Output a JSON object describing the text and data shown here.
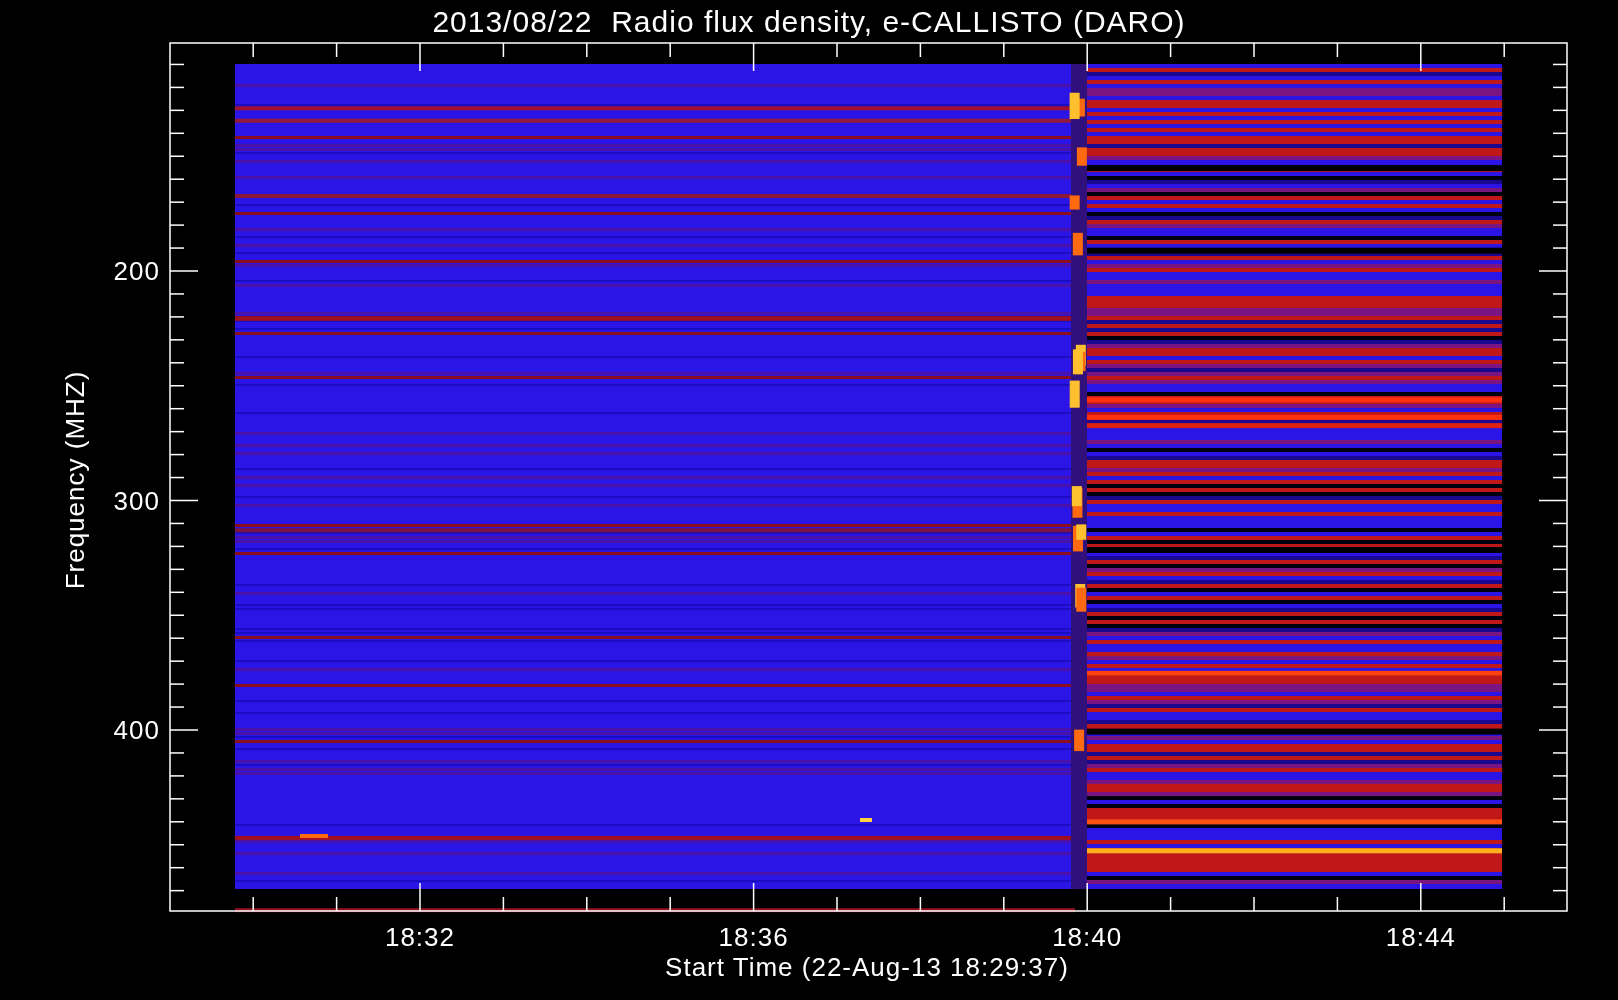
{
  "title": "2013/08/22  Radio flux density, e-CALLISTO (DARO)",
  "y_axis": {
    "label": "Frequency (MHZ)",
    "ticks": [
      "200",
      "300",
      "400"
    ]
  },
  "x_axis": {
    "label": "Start Time (22-Aug-13 18:29:37)",
    "ticks": [
      "18:32",
      "18:36",
      "18:40",
      "18:44"
    ]
  }
}
